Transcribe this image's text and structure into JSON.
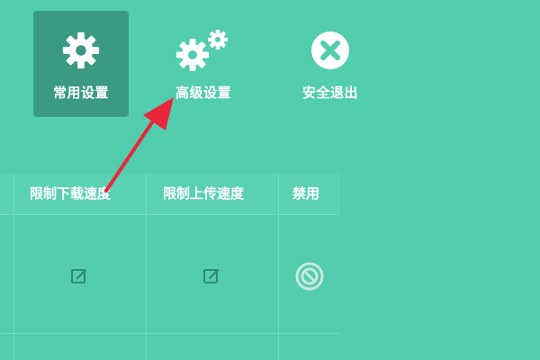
{
  "toolbar": {
    "items": [
      {
        "label": "常用设置",
        "icon": "gear-icon",
        "active": true
      },
      {
        "label": "高级设置",
        "icon": "gears-icon",
        "active": false
      },
      {
        "label": "安全退出",
        "icon": "close-circle-icon",
        "active": false
      }
    ]
  },
  "table": {
    "headers": [
      "限制下载速度",
      "限制上传速度",
      "禁用"
    ],
    "rows": [
      {
        "download_limit": "edit-icon",
        "upload_limit": "edit-icon",
        "disable": "ban-icon"
      }
    ]
  },
  "colors": {
    "background": "#52cdae",
    "active_tab": "#3b9a83",
    "edit_icon": "#2e8b6f",
    "ban_icon": "#c9e9df",
    "arrow": "#e8283a"
  }
}
